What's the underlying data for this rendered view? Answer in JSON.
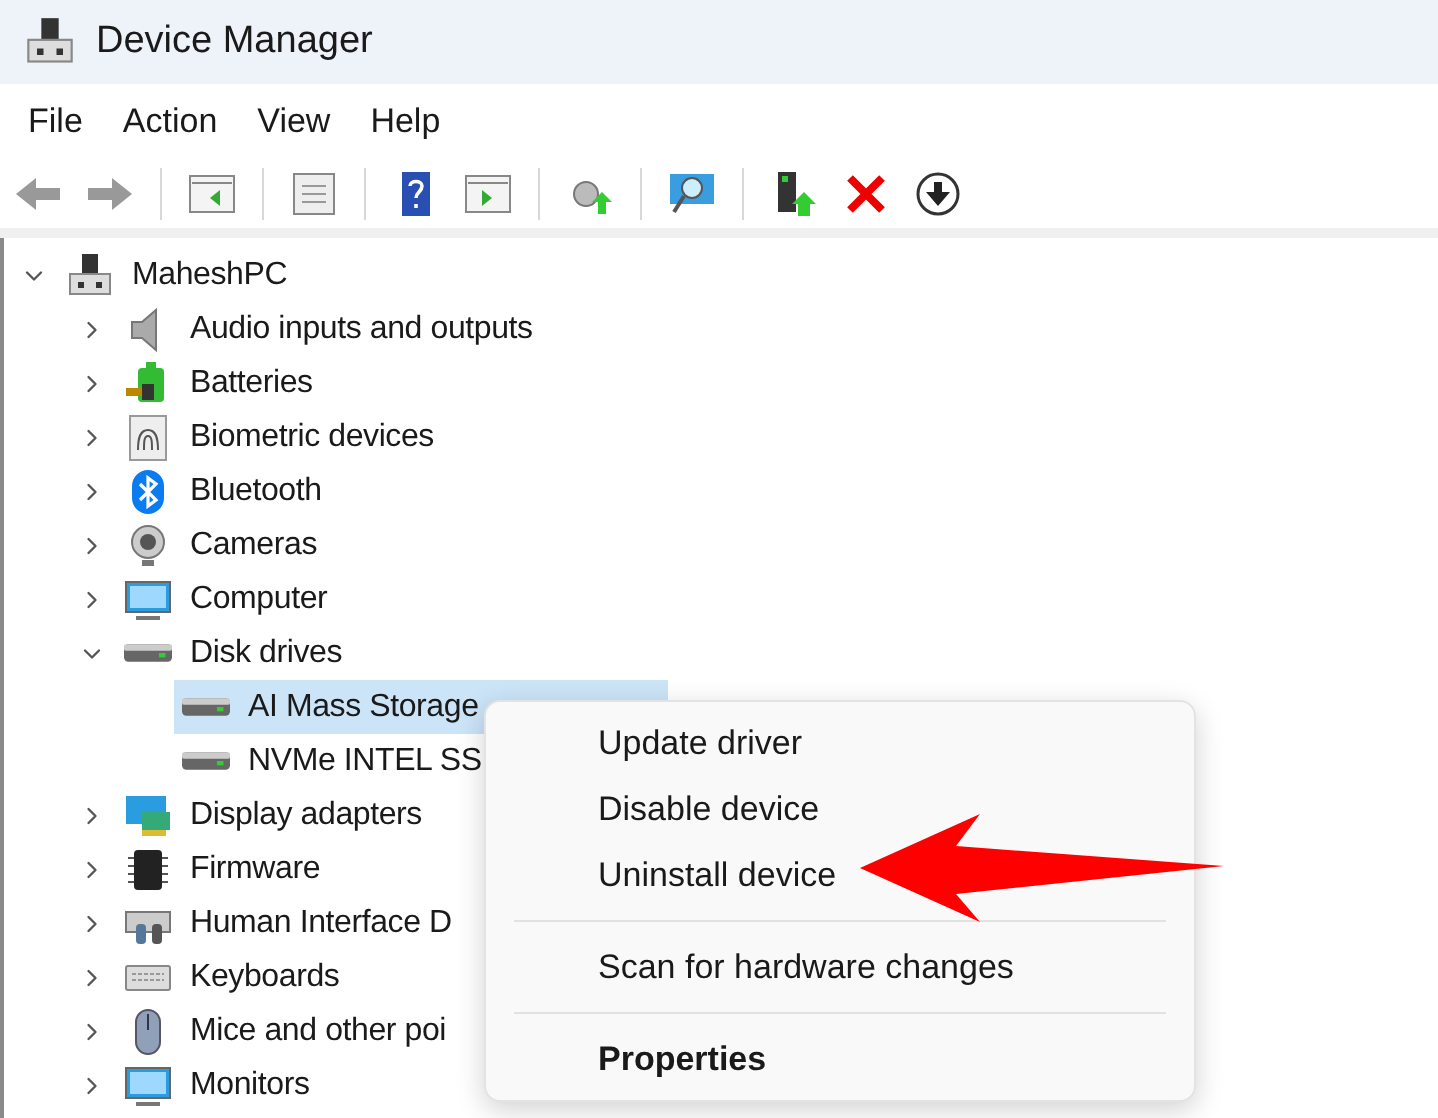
{
  "window": {
    "title": "Device Manager"
  },
  "menu_bar": [
    "File",
    "Action",
    "View",
    "Help"
  ],
  "tree": {
    "label": "MaheshPC",
    "expanded": true,
    "children": [
      {
        "label": "Audio inputs and outputs",
        "expanded": false
      },
      {
        "label": "Batteries",
        "expanded": false
      },
      {
        "label": "Biometric devices",
        "expanded": false
      },
      {
        "label": "Bluetooth",
        "expanded": false
      },
      {
        "label": "Cameras",
        "expanded": false
      },
      {
        "label": "Computer",
        "expanded": false
      },
      {
        "label": "Disk drives",
        "expanded": true,
        "children": [
          {
            "label": "AI Mass Storage",
            "selected": true
          },
          {
            "label": "NVMe INTEL SS",
            "selected": false
          }
        ]
      },
      {
        "label": "Display adapters",
        "expanded": false
      },
      {
        "label": "Firmware",
        "expanded": false
      },
      {
        "label": "Human Interface D",
        "expanded": false
      },
      {
        "label": "Keyboards",
        "expanded": false
      },
      {
        "label": "Mice and other poi",
        "expanded": false
      },
      {
        "label": "Monitors",
        "expanded": false
      }
    ]
  },
  "context_menu": {
    "items": [
      {
        "kind": "item",
        "label": "Update driver"
      },
      {
        "kind": "item",
        "label": "Disable device"
      },
      {
        "kind": "item",
        "label": "Uninstall device"
      },
      {
        "kind": "separator"
      },
      {
        "kind": "item",
        "label": "Scan for hardware changes"
      },
      {
        "kind": "separator"
      },
      {
        "kind": "default",
        "label": "Properties"
      }
    ]
  }
}
